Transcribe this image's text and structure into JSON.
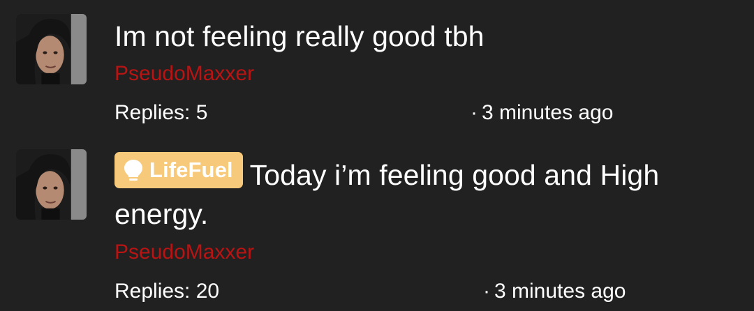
{
  "threads": [
    {
      "title": "Im not feeling really good tbh",
      "author": "PseudoMaxxer",
      "replies": "Replies: 5",
      "separator": "·",
      "time": "3 minutes ago",
      "avatar_icon": "user-photo-avatar"
    },
    {
      "flair": {
        "label": "LifeFuel",
        "icon": "lightbulb-icon",
        "color": "#f7c97a"
      },
      "title": "Today i’m feeling good and High energy.",
      "author": "PseudoMaxxer",
      "replies": "Replies: 20",
      "separator": "·",
      "time": "3 minutes ago",
      "avatar_icon": "user-photo-avatar"
    }
  ],
  "colors": {
    "background": "#212121",
    "author": "#b81414",
    "text": "#ffffff"
  }
}
